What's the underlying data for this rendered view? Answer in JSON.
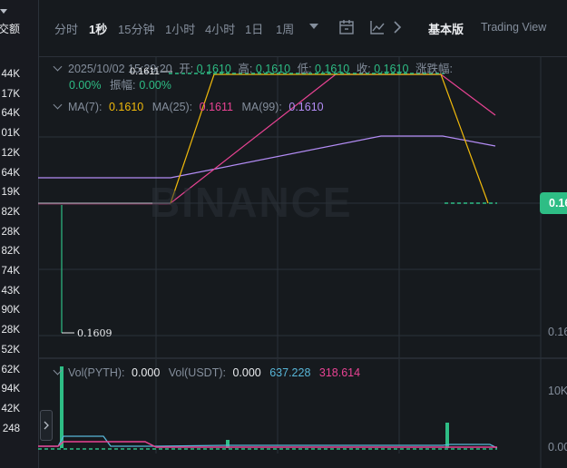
{
  "left_column": {
    "header": "交额",
    "values": [
      "44K",
      "17K",
      "64K",
      "01K",
      "12K",
      "64K",
      "19K",
      "82K",
      "28K",
      "82K",
      "74K",
      "43K",
      "90K",
      "28K",
      "52K",
      "62K",
      "94K",
      "42K",
      "248"
    ]
  },
  "toolbar": {
    "timeframes": [
      {
        "label": "分时",
        "active": false
      },
      {
        "label": "1秒",
        "active": true
      },
      {
        "label": "15分钟",
        "active": false
      },
      {
        "label": "1小时",
        "active": false
      },
      {
        "label": "4小时",
        "active": false
      },
      {
        "label": "1日",
        "active": false
      },
      {
        "label": "1周",
        "active": false
      }
    ],
    "version_basic": "基本版",
    "version_tv": "Trading View"
  },
  "ohlc": {
    "datetime": "2025/10/02 15:29:20",
    "open_label": "开:",
    "open": "0.1610",
    "high_label": "高:",
    "high": "0.1610",
    "low_label": "低:",
    "low": "0.1610",
    "close_label": "收:",
    "close": "0.1610",
    "change_label": "涨跌幅:",
    "change": "0.00%",
    "amplitude_label": "振幅:",
    "amplitude": "0.00%"
  },
  "ma": {
    "ma7_label": "MA(7):",
    "ma7": "0.1610",
    "ma25_label": "MA(25):",
    "ma25": "0.1611",
    "ma99_label": "MA(99):",
    "ma99": "0.1610"
  },
  "chart": {
    "high_marker": "0.1611",
    "low_marker": "0.1609",
    "current_price": "0.16",
    "right_axis_label": "0.16",
    "watermark": "BINANCE"
  },
  "volume": {
    "vol_pyth_label": "Vol(PYTH):",
    "vol_pyth": "0.000",
    "vol_usdt_label": "Vol(USDT):",
    "vol_usdt": "0.000",
    "ma_a": "637.228",
    "ma_b": "318.614",
    "axis_top": "10K",
    "axis_bottom": "0.00"
  },
  "colors": {
    "up": "#2ebd85",
    "ma7": "#f0b90b",
    "ma25": "#e84393",
    "ma99": "#b38cf5",
    "vol_ma_a": "#2ebd85",
    "vol_ma_b": "#e84393"
  }
}
